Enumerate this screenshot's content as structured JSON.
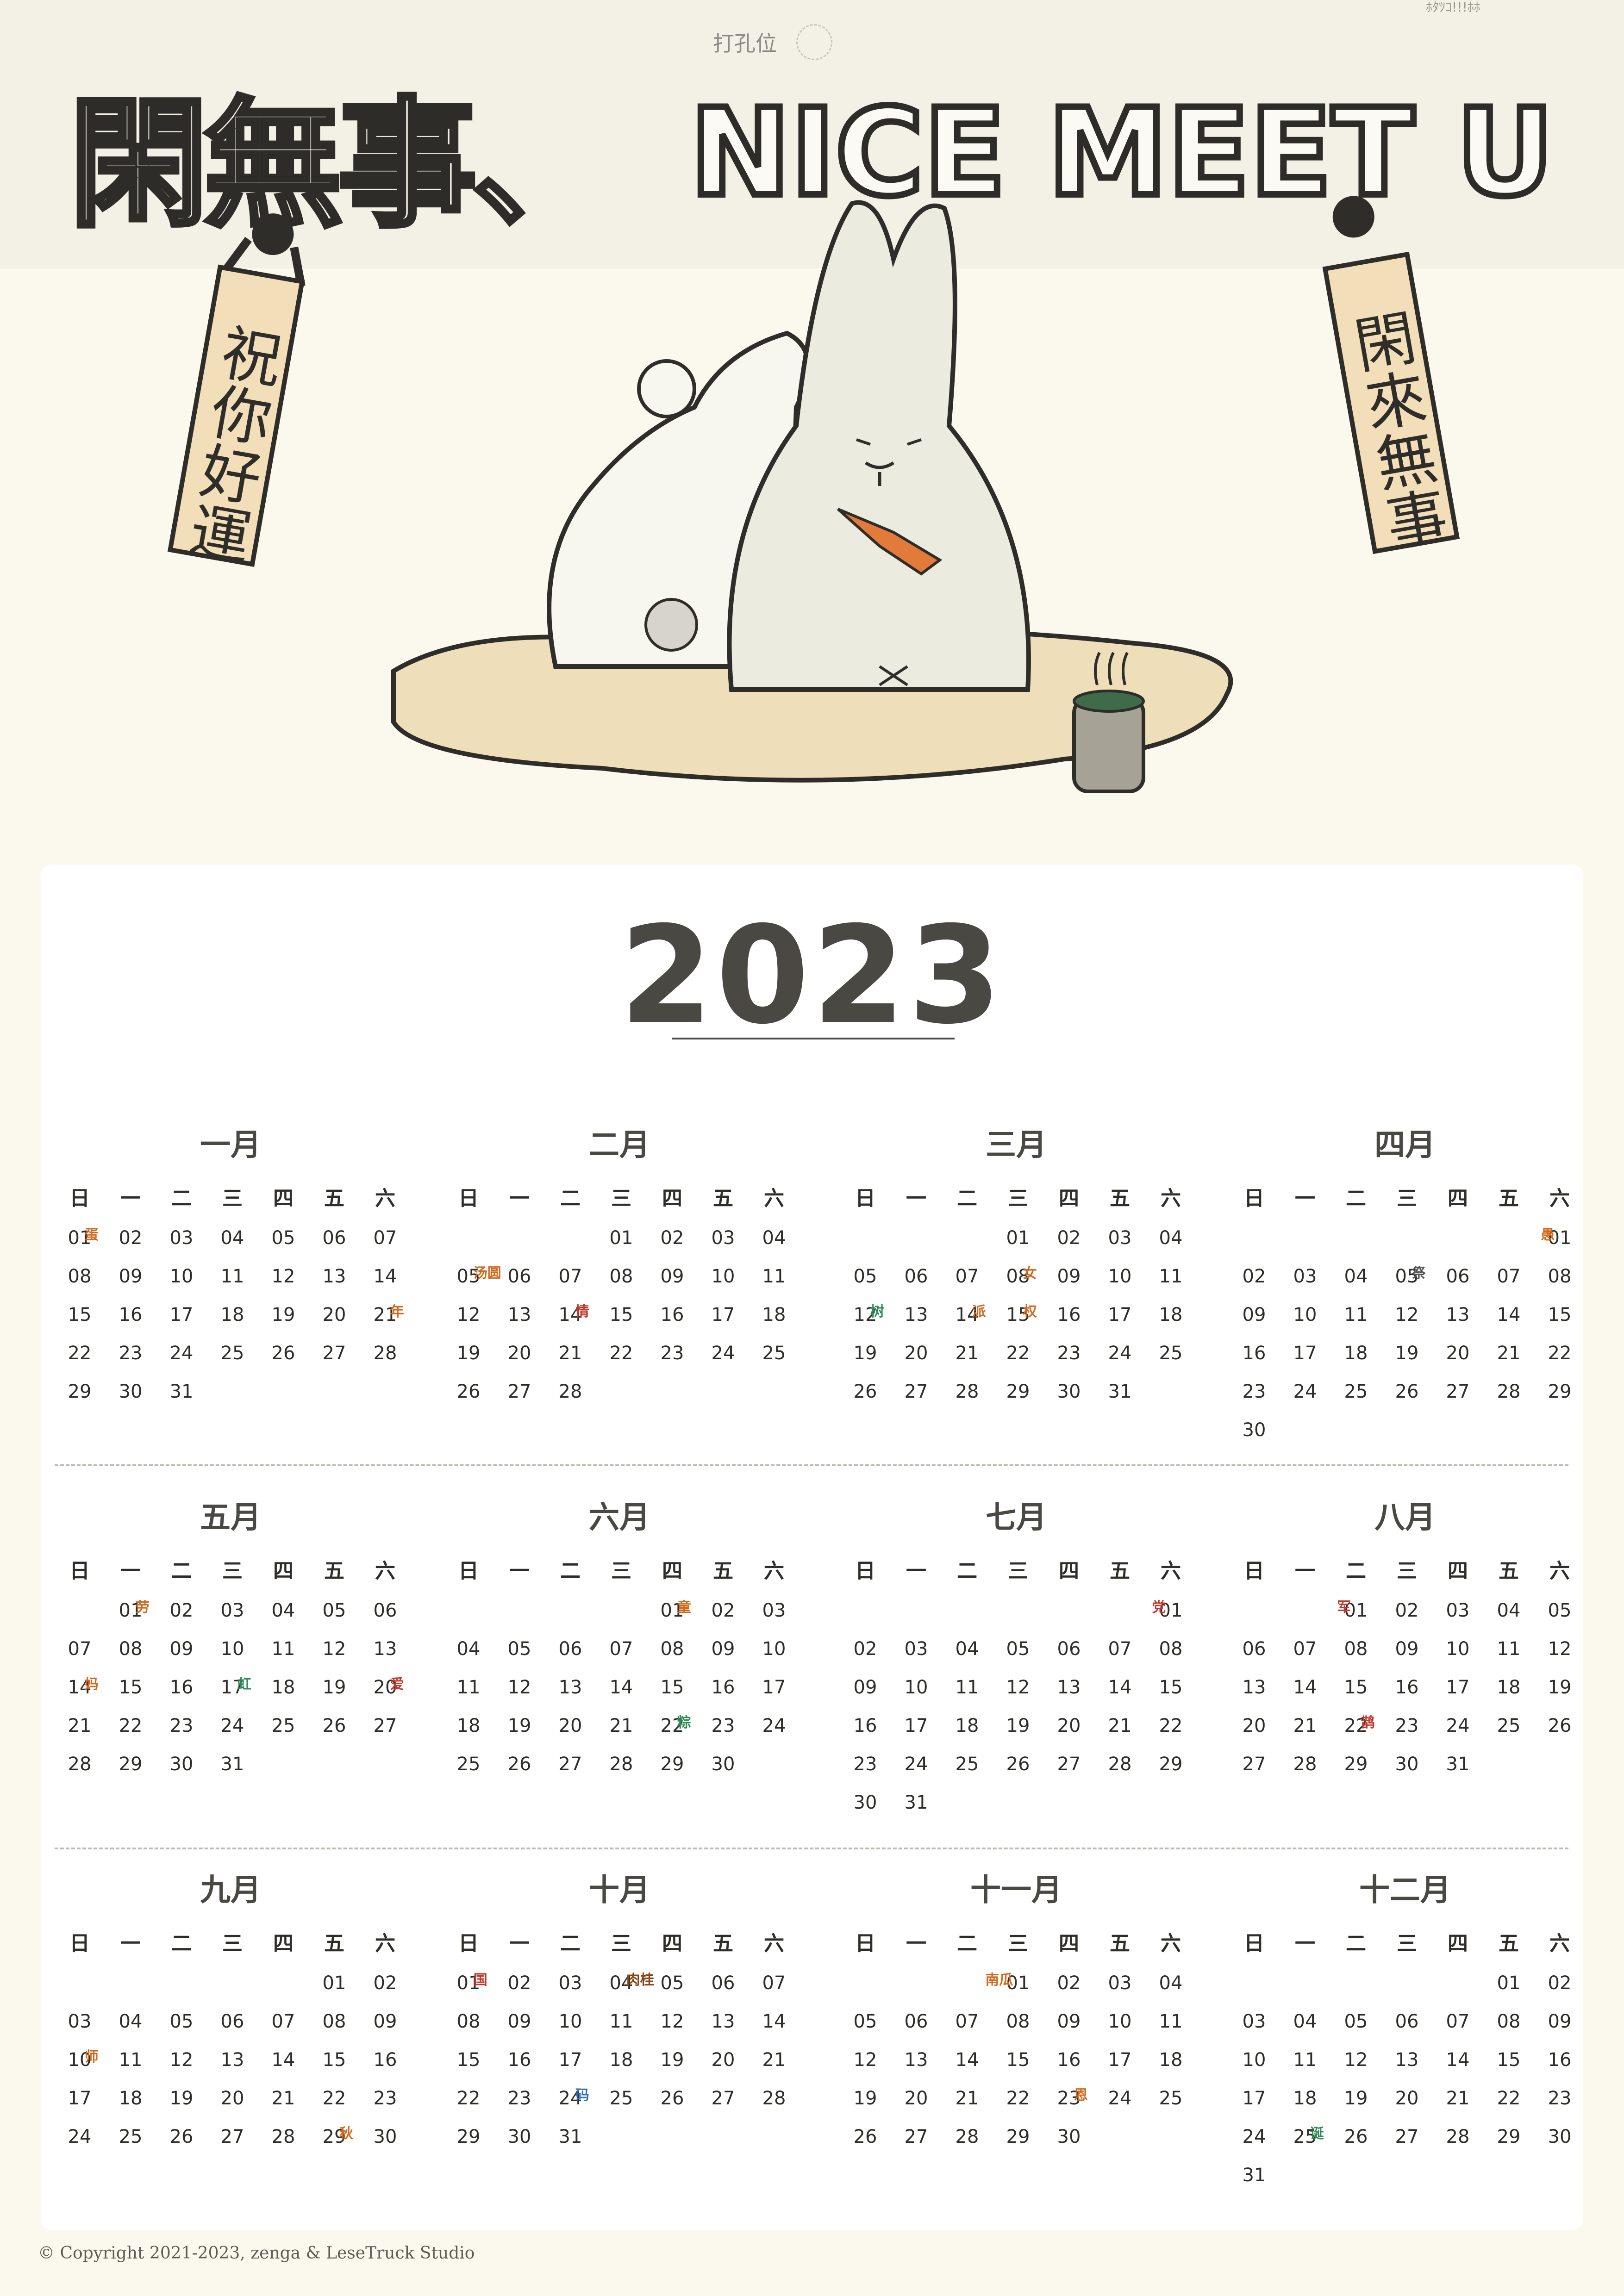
{
  "header": {
    "hole_label": "打孔位",
    "corner_text": "ﾎﾀﾂｺ!!!ﾎﾎ",
    "title_left": "閑無事、",
    "title_right": "NICE MEET U",
    "left_tag": "祝你好運",
    "right_tag": "閑來無事"
  },
  "calendar": {
    "year": "2023",
    "weekdays": [
      "日",
      "一",
      "二",
      "三",
      "四",
      "五",
      "六"
    ],
    "months": [
      {
        "name": "一月",
        "start": 0,
        "days": 31,
        "festivals": {
          "1": [
            "蛋",
            "#d2691e"
          ],
          "21": [
            "年",
            "#d2691e"
          ]
        }
      },
      {
        "name": "二月",
        "start": 3,
        "days": 28,
        "festivals": {
          "5": [
            "汤圆",
            "#d2691e"
          ],
          "14": [
            "情",
            "#c0392b"
          ]
        }
      },
      {
        "name": "三月",
        "start": 3,
        "days": 31,
        "festivals": {
          "8": [
            "女",
            "#d2691e"
          ],
          "12": [
            "树",
            "#2e8b57"
          ],
          "14": [
            "派",
            "#d2691e"
          ],
          "15": [
            "权",
            "#d2691e"
          ]
        }
      },
      {
        "name": "四月",
        "start": 6,
        "days": 30,
        "festivals": {
          "1": [
            "愚",
            "#d2691e",
            "left"
          ],
          "5": [
            "祭",
            "#555555"
          ]
        }
      },
      {
        "name": "五月",
        "start": 1,
        "days": 31,
        "festivals": {
          "1": [
            "劳",
            "#d2691e"
          ],
          "14": [
            "妈",
            "#d2691e"
          ],
          "17": [
            "虹",
            "#2e8b57"
          ],
          "20": [
            "爱",
            "#c0392b"
          ]
        }
      },
      {
        "name": "六月",
        "start": 4,
        "days": 30,
        "festivals": {
          "1": [
            "童",
            "#d2691e"
          ],
          "22": [
            "粽",
            "#2e8b57"
          ]
        }
      },
      {
        "name": "七月",
        "start": 6,
        "days": 31,
        "festivals": {
          "1": [
            "党",
            "#c0392b",
            "left"
          ]
        }
      },
      {
        "name": "八月",
        "start": 2,
        "days": 31,
        "festivals": {
          "1": [
            "军",
            "#c0392b",
            "left"
          ],
          "22": [
            "鹊",
            "#c0392b"
          ]
        }
      },
      {
        "name": "九月",
        "start": 5,
        "days": 30,
        "festivals": {
          "10": [
            "师",
            "#d2691e"
          ],
          "29": [
            "秋",
            "#d2691e"
          ]
        }
      },
      {
        "name": "十月",
        "start": 0,
        "days": 31,
        "festivals": {
          "1": [
            "国",
            "#c0392b"
          ],
          "4": [
            "肉桂",
            "#8b4513"
          ],
          "24": [
            "码",
            "#2f6fb0"
          ]
        }
      },
      {
        "name": "十一月",
        "start": 3,
        "days": 30,
        "festivals": {
          "1": [
            "南瓜",
            "#d2691e",
            "left"
          ],
          "23": [
            "恩",
            "#d2691e"
          ]
        }
      },
      {
        "name": "十二月",
        "start": 5,
        "days": 31,
        "festivals": {
          "25": [
            "诞",
            "#2e8b57"
          ]
        }
      }
    ]
  },
  "footer": {
    "copyright": "© Copyright 2021-2023, zenga & LeseTruck Studio"
  }
}
